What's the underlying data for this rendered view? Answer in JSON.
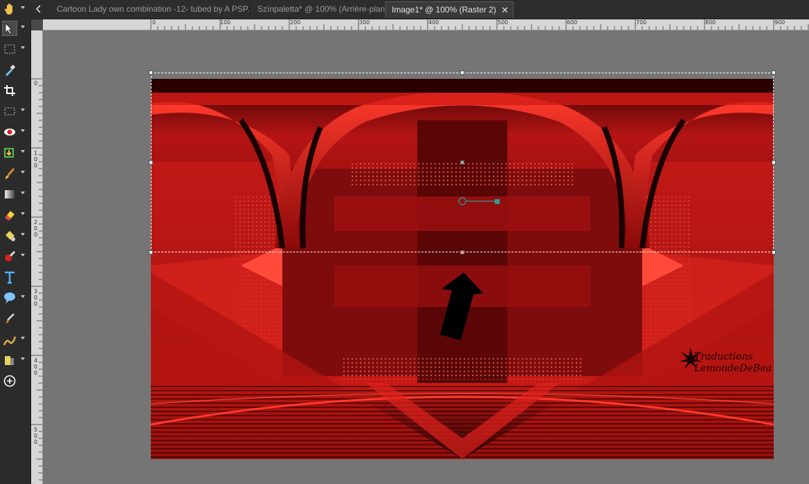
{
  "tabs": [
    {
      "label": "Cartoon Lady own combination -12- tubed by A PSP...",
      "active": false
    },
    {
      "label": "Színpaletta* @ 100% (Arrière-plan)",
      "active": false
    },
    {
      "label": "Image1* @ 100% (Raster 2)",
      "active": true
    }
  ],
  "tab_close_glyph": "✕",
  "ruler_top_labels": [
    "0",
    "100",
    "200",
    "300",
    "400",
    "500",
    "600",
    "700",
    "800",
    "900"
  ],
  "ruler_left_labels": [
    "0",
    "1\n0\n0",
    "2\n0\n0",
    "3\n0\n0",
    "4\n0\n0",
    "5\n0\n0"
  ],
  "tools": [
    {
      "name": "pan-icon",
      "has_menu": true
    },
    {
      "name": "pick-icon",
      "has_menu": true,
      "active": true
    },
    {
      "name": "selection-icon",
      "has_menu": true
    },
    {
      "name": "dropper-icon",
      "has_menu": false
    },
    {
      "name": "crop-icon",
      "has_menu": false
    },
    {
      "name": "straighten-icon",
      "has_menu": true
    },
    {
      "name": "red-eye-icon",
      "has_menu": true
    },
    {
      "name": "clone-icon",
      "has_menu": true
    },
    {
      "name": "paint-brush-icon",
      "has_menu": true
    },
    {
      "name": "gradient-icon",
      "has_menu": true
    },
    {
      "name": "eraser-icon",
      "has_menu": true
    },
    {
      "name": "fill-icon",
      "has_menu": true
    },
    {
      "name": "color-replacer-icon",
      "has_menu": true
    },
    {
      "name": "text-icon",
      "has_menu": false
    },
    {
      "name": "preset-shape-icon",
      "has_menu": true
    },
    {
      "name": "pen-icon",
      "has_menu": false
    },
    {
      "name": "art-brush-icon",
      "has_menu": true
    },
    {
      "name": "picture-tube-icon",
      "has_menu": true
    },
    {
      "name": "add-tools-icon",
      "has_menu": false
    }
  ],
  "watermark": {
    "line1": "Traductions",
    "line2": "LemondeDeBea"
  },
  "colors": {
    "accent_red": "#e0201c",
    "dark_red": "#4a0202",
    "toolbar_bg": "#2b2b2b",
    "workspace_bg": "#757575"
  }
}
